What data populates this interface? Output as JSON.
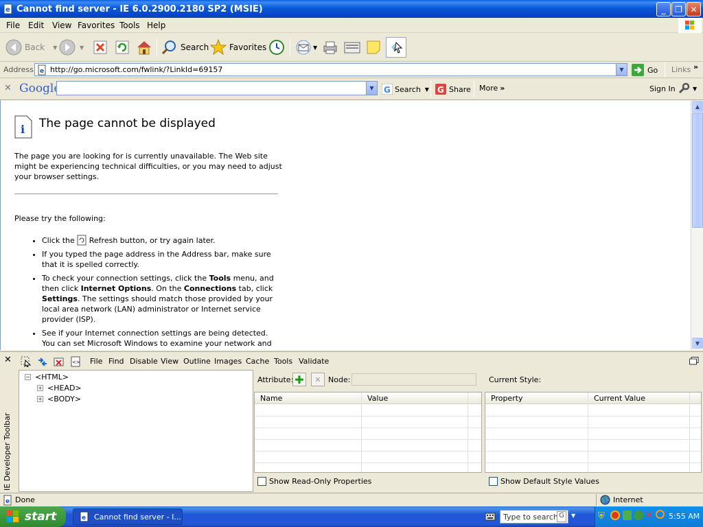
{
  "window": {
    "title": "Cannot find server - IE 6.0.2900.2180 SP2 (MSIE)"
  },
  "menu": [
    "File",
    "Edit",
    "View",
    "Favorites",
    "Tools",
    "Help"
  ],
  "toolbar": {
    "back": "Back",
    "search": "Search",
    "favorites": "Favorites"
  },
  "address": {
    "label": "Address",
    "url": "http://go.microsoft.com/fwlink/?LinkId=69157",
    "go": "Go",
    "links": "Links"
  },
  "google": {
    "logo": "Google",
    "search": "Search",
    "share": "Share",
    "more": "More",
    "signin": "Sign In"
  },
  "page": {
    "title": "The page cannot be displayed",
    "intro": "The page you are looking for is currently unavailable. The Web site might be experiencing technical difficulties, or you may need to adjust your browser settings.",
    "try": "Please try the following:",
    "bullets": [
      {
        "a": "Click the ",
        "b": " Refresh button, or try again later."
      },
      {
        "a": "If you typed the page address in the Address bar, make sure that it is spelled correctly."
      },
      {
        "a": "To check your connection settings, click the ",
        "b1": "Tools",
        "c": " menu, and then click ",
        "b2": "Internet Options",
        "d": ". On the ",
        "b3": "Connections",
        "e": " tab, click ",
        "b4": "Settings",
        "f": ". The settings should match those provided by your local area network (LAN) administrator or Internet service provider (ISP)."
      },
      {
        "a": "See if your Internet connection settings are being detected. You can set Microsoft Windows to examine your network and automatically discover network connection settings (if"
      }
    ]
  },
  "devtoolbar": {
    "menu": [
      "File",
      "Find",
      "Disable",
      "View",
      "Outline",
      "Images",
      "Cache",
      "Tools",
      "Validate"
    ],
    "side_label": "IE Developer Toolbar",
    "tree": [
      "<HTML>",
      "<HEAD>",
      "<BODY>"
    ],
    "attribute_label": "Attribute:",
    "node_label": "Node:",
    "attr_cols": [
      "Name",
      "Value"
    ],
    "show_readonly": "Show Read-Only Properties",
    "current_style": "Current Style:",
    "style_cols": [
      "Property",
      "Current Value"
    ],
    "show_default": "Show Default Style Values"
  },
  "status": {
    "text": "Done",
    "zone": "Internet"
  },
  "taskbar": {
    "start": "start",
    "item": "Cannot find server - I...",
    "search_placeholder": "Type to search",
    "clock": "5:55 AM"
  }
}
